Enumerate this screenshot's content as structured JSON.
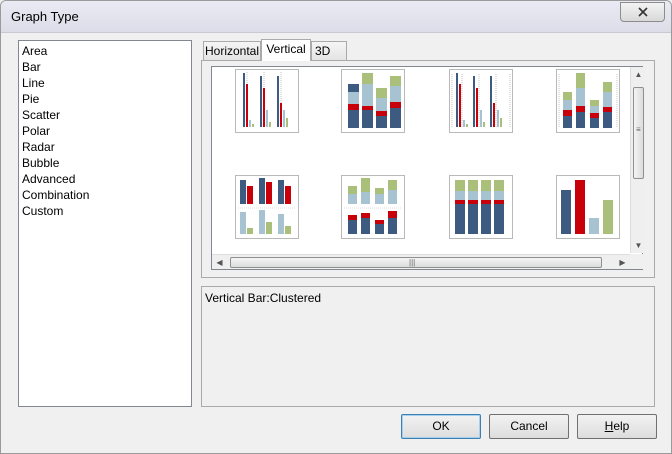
{
  "window": {
    "title": "Graph Type"
  },
  "graph_types": [
    "Area",
    "Bar",
    "Line",
    "Pie",
    "Scatter",
    "Polar",
    "Radar",
    "Bubble",
    "Advanced",
    "Combination",
    "Custom"
  ],
  "tabs": [
    "Horizontal",
    "Vertical",
    "3D"
  ],
  "active_tab": "Vertical",
  "gallery_thumbnails": [
    "vertical-bar-clustered-thumbnail",
    "vertical-bar-stacked-thumbnail",
    "vertical-bar-clustered-gridlines-thumbnail",
    "vertical-bar-stacked-gridlines-thumbnail",
    "vertical-bar-split-thumbnail",
    "vertical-bar-stacked-split-thumbnail",
    "vertical-bar-100-percent-stacked-thumbnail",
    "vertical-bar-single-series-thumbnail"
  ],
  "description": "Vertical Bar:Clustered",
  "buttons": {
    "ok": "OK",
    "cancel": "Cancel",
    "help_first": "H",
    "help_rest": "elp"
  },
  "colors": {
    "navy": "#3d5b80",
    "red": "#c8000a",
    "light_blue": "#a7c2d1",
    "sage": "#a9bf7a"
  },
  "icons": [
    "close-icon",
    "scroll-up-icon",
    "scroll-down-icon",
    "scroll-left-icon",
    "scroll-right-icon"
  ]
}
